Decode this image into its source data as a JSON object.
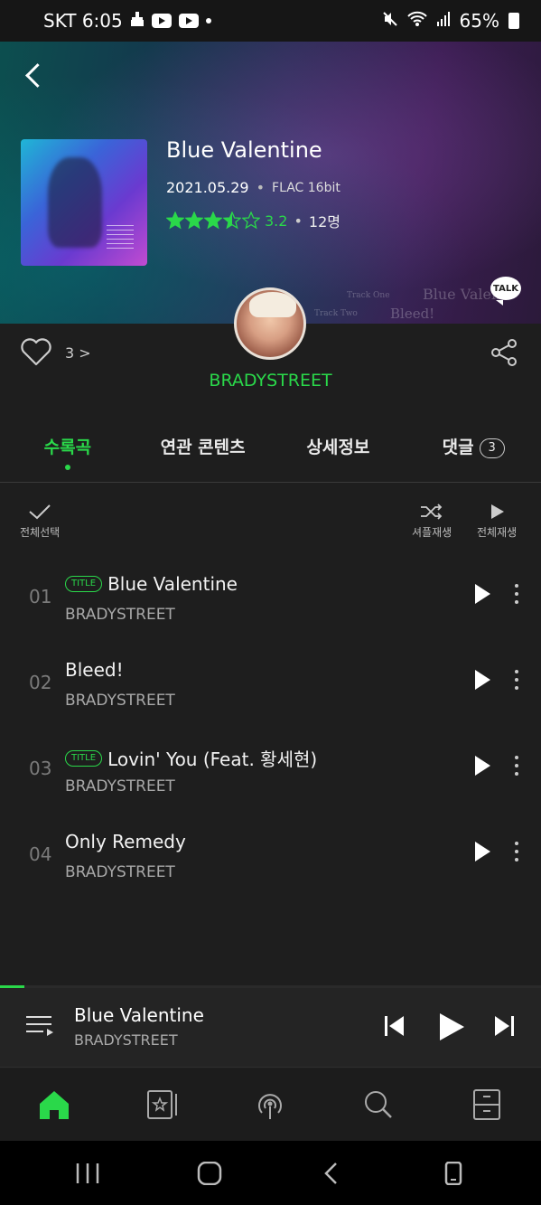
{
  "status_bar": {
    "carrier_time": "SKT 6:05",
    "battery": "65%"
  },
  "album": {
    "title": "Blue Valentine",
    "release_date": "2021.05.29",
    "quality": "FLAC 16bit",
    "rating_score": "3.2",
    "rating_count": "12명",
    "rating_value": 3.5,
    "like_count": "3 >"
  },
  "hero_decor": {
    "text1": "Blue Valen",
    "text2": "Bleed!",
    "track_one": "Track One",
    "track_two": "Track Two"
  },
  "talk_badge": "TALK",
  "artist": {
    "name": "BRADYSTREET"
  },
  "tabs": [
    {
      "label": "수록곡",
      "active": true
    },
    {
      "label": "연관 콘텐츠"
    },
    {
      "label": "상세정보"
    },
    {
      "label": "댓글",
      "count": "3"
    }
  ],
  "toolbar": {
    "select_all": "전체선택",
    "shuffle": "셔플재생",
    "play_all": "전체재생"
  },
  "tracks": [
    {
      "num": "01",
      "title": "Blue Valentine",
      "badge": "TITLE",
      "artist": "BRADYSTREET"
    },
    {
      "num": "02",
      "title": "Bleed!",
      "badge": "",
      "artist": "BRADYSTREET"
    },
    {
      "num": "03",
      "title": "Lovin' You (Feat. 황세현)",
      "badge": "TITLE",
      "artist": "BRADYSTREET"
    },
    {
      "num": "04",
      "title": "Only Remedy",
      "badge": "",
      "artist": "BRADYSTREET"
    }
  ],
  "player": {
    "title": "Blue Valentine",
    "artist": "BRADYSTREET",
    "progress": 0.045
  },
  "colors": {
    "accent": "#2ad84a",
    "background": "#1e1e1e",
    "player_bg": "#242424"
  },
  "icons": {
    "nav": [
      "home-icon",
      "library-icon",
      "podcast-icon",
      "search-icon",
      "storage-icon"
    ],
    "player": [
      "previous-icon",
      "play-icon",
      "next-icon"
    ]
  }
}
